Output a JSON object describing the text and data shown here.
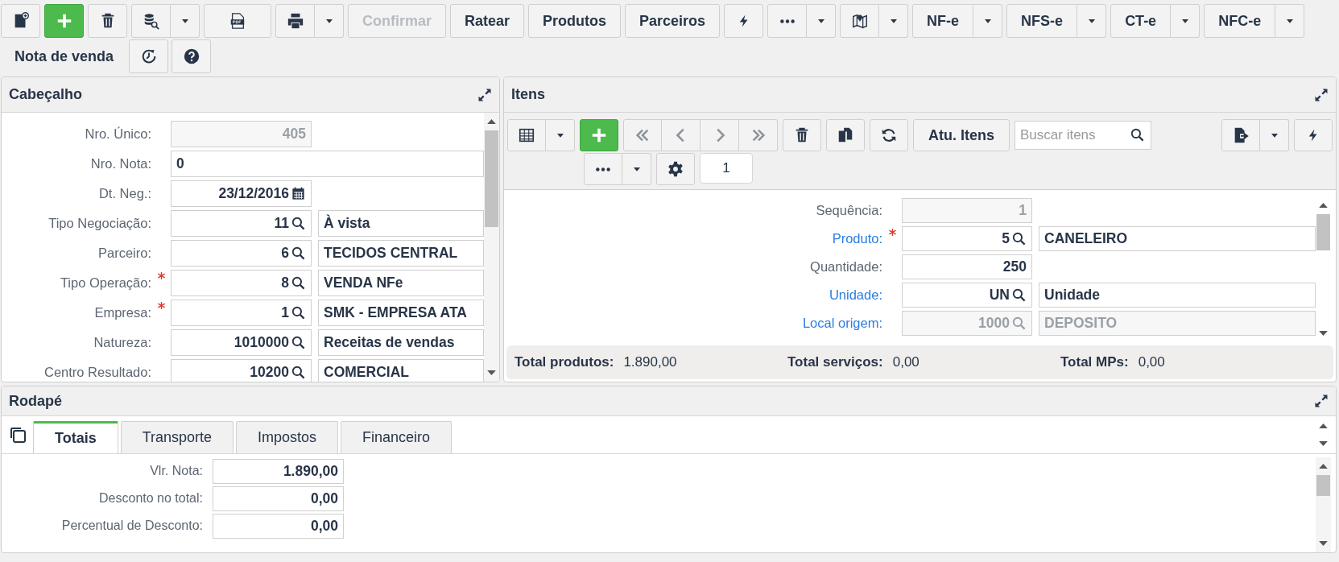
{
  "toolbar": {
    "buttons": [
      {
        "label": "Confirmar",
        "disabled": true
      },
      {
        "label": "Ratear",
        "disabled": false
      },
      {
        "label": "Produtos",
        "disabled": false
      },
      {
        "label": "Parceiros",
        "disabled": false
      }
    ],
    "document_menus": [
      {
        "label": "NF-e"
      },
      {
        "label": "NFS-e"
      },
      {
        "label": "CT-e"
      },
      {
        "label": "NFC-e"
      }
    ],
    "screen_title": "Nota de venda"
  },
  "header_panel": {
    "title": "Cabeçalho",
    "fields": [
      {
        "label": "Nro. Único:",
        "kind": "readonly",
        "value": "405",
        "required": false
      },
      {
        "label": "Nro. Nota:",
        "kind": "wide-text",
        "value": "0",
        "required": false
      },
      {
        "label": "Dt. Neg.:",
        "kind": "date",
        "value": "23/12/2016",
        "required": false
      },
      {
        "label": "Tipo Negociação:",
        "kind": "lookup",
        "value": "11",
        "description": "À vista",
        "required": false
      },
      {
        "label": "Parceiro:",
        "kind": "lookup",
        "value": "6",
        "description": "TECIDOS CENTRAL",
        "required": false
      },
      {
        "label": "Tipo Operação:",
        "kind": "lookup",
        "value": "8",
        "description": "VENDA NFe",
        "required": true
      },
      {
        "label": "Empresa:",
        "kind": "lookup",
        "value": "1",
        "description": "SMK - EMPRESA ATA",
        "required": true
      },
      {
        "label": "Natureza:",
        "kind": "lookup",
        "value": "1010000",
        "description": "Receitas de vendas",
        "required": false
      },
      {
        "label": "Centro Resultado:",
        "kind": "lookup",
        "value": "10200",
        "description": "COMERCIAL",
        "required": false
      }
    ]
  },
  "items_panel": {
    "title": "Itens",
    "refresh_button": "Atu. Itens",
    "search": {
      "placeholder": "Buscar itens"
    },
    "record_badge": "1",
    "fields": [
      {
        "label": "Sequência:",
        "kind": "readonly",
        "value": "1",
        "required": false,
        "link": false
      },
      {
        "label": "Produto:",
        "kind": "lookup",
        "value": "5",
        "description": "CANELEIRO",
        "required": true,
        "link": true
      },
      {
        "label": "Quantidade:",
        "kind": "text",
        "value": "250",
        "required": false,
        "link": false
      },
      {
        "label": "Unidade:",
        "kind": "lookup",
        "value": "UN",
        "description": "Unidade",
        "required": false,
        "link": true
      },
      {
        "label": "Local origem:",
        "kind": "readonly-lookup",
        "value": "1000",
        "description": "DEPOSITO",
        "required": false,
        "link": true
      }
    ],
    "totals": [
      {
        "label": "Total produtos:",
        "value": "1.890,00"
      },
      {
        "label": "Total serviços:",
        "value": "0,00"
      },
      {
        "label": "Total MPs:",
        "value": "0,00"
      }
    ]
  },
  "footer_panel": {
    "title": "Rodapé",
    "tabs": [
      {
        "label": "Totais",
        "selected": true
      },
      {
        "label": "Transporte",
        "selected": false
      },
      {
        "label": "Impostos",
        "selected": false
      },
      {
        "label": "Financeiro",
        "selected": false
      }
    ],
    "fields": [
      {
        "label": "Vlr. Nota:",
        "value": "1.890,00"
      },
      {
        "label": "Desconto no total:",
        "value": "0,00"
      },
      {
        "label": "Percentual de Desconto:",
        "value": "0,00"
      }
    ]
  }
}
